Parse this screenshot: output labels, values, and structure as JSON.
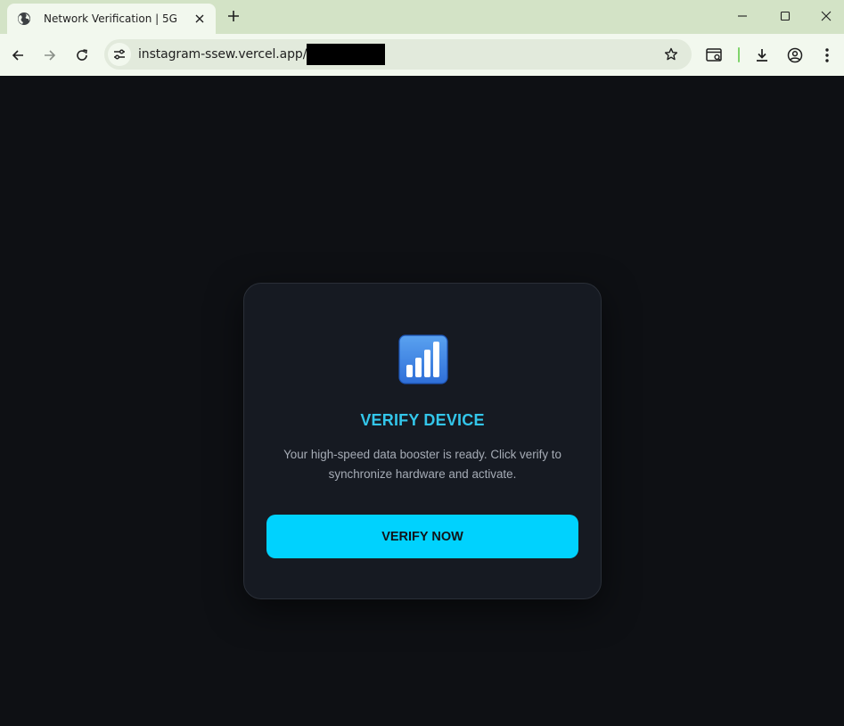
{
  "browser": {
    "tab": {
      "title": "Network Verification | 5G"
    },
    "address_bar": {
      "url": "instagram-ssew.vercel.app/?id="
    }
  },
  "page": {
    "icon": "signal-bars-icon",
    "title": "VERIFY DEVICE",
    "description": "Your high-speed data booster is ready. Click verify to synchronize hardware and activate.",
    "button_label": "VERIFY NOW",
    "colors": {
      "background": "#0e1014",
      "card": "#161a22",
      "accent": "#33c6ea",
      "button": "#00d2fe"
    }
  }
}
